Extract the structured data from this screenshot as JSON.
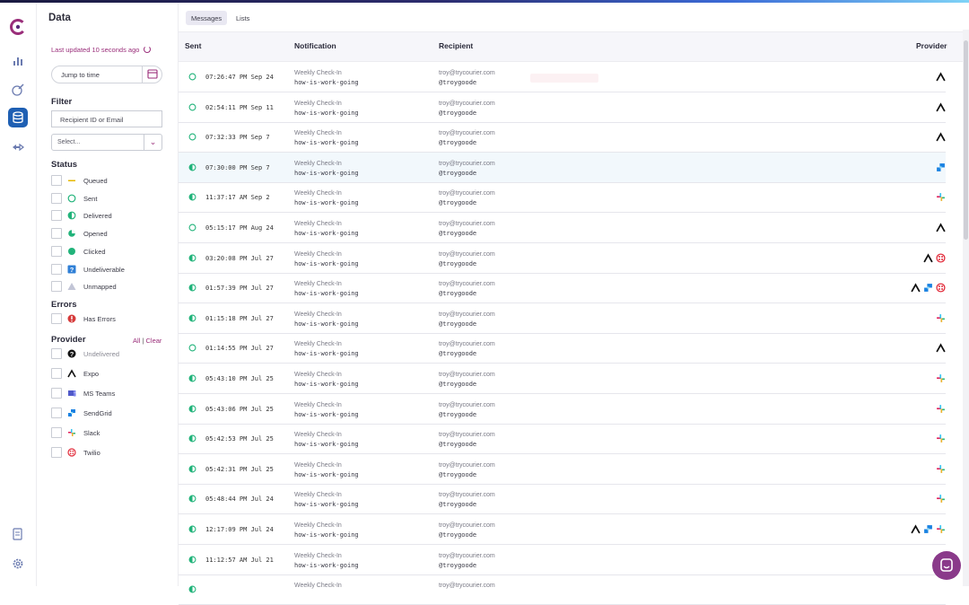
{
  "sidebar": {
    "title": "Data",
    "last_updated": "Last updated 10 seconds ago",
    "jump_placeholder": "Jump to time",
    "filter_heading": "Filter",
    "recipient_placeholder": "Recipient ID or Email",
    "select_placeholder": "Select...",
    "status_heading": "Status",
    "status_items": [
      {
        "label": "Queued",
        "icon": "queued-dash-icon"
      },
      {
        "label": "Sent",
        "icon": "circle-outline-icon"
      },
      {
        "label": "Delivered",
        "icon": "half-circle-icon"
      },
      {
        "label": "Opened",
        "icon": "three-quarter-circle-icon"
      },
      {
        "label": "Clicked",
        "icon": "filled-circle-icon"
      },
      {
        "label": "Undeliverable",
        "icon": "question-square-icon"
      },
      {
        "label": "Unmapped",
        "icon": "triangle-icon"
      }
    ],
    "errors_heading": "Errors",
    "error_items": [
      {
        "label": "Has Errors",
        "icon": "error-icon"
      }
    ],
    "provider_heading": "Provider",
    "provider_all": "All",
    "provider_sep": "|",
    "provider_clear": "Clear",
    "provider_items": [
      {
        "label": "Undelivered",
        "icon": "undelivered-question-icon"
      },
      {
        "label": "Expo",
        "icon": "expo-icon"
      },
      {
        "label": "MS Teams",
        "icon": "ms-teams-icon"
      },
      {
        "label": "SendGrid",
        "icon": "sendgrid-icon"
      },
      {
        "label": "Slack",
        "icon": "slack-icon"
      },
      {
        "label": "Twilio",
        "icon": "twilio-icon"
      }
    ]
  },
  "tabs": [
    {
      "label": "Messages",
      "active": true
    },
    {
      "label": "Lists",
      "active": false
    }
  ],
  "table": {
    "columns": {
      "sent": "Sent",
      "notification": "Notification",
      "recipient": "Recipient",
      "provider": "Provider"
    },
    "rows": [
      {
        "status": "sent",
        "sent": "07:26:47 PM Sep 24",
        "notification": "Weekly Check-In",
        "template": "how-is-work-going",
        "email": "troy@trycourier.com",
        "handle": "@troygoode",
        "providers": [
          "expo"
        ]
      },
      {
        "status": "sent",
        "sent": "02:54:11 PM Sep 11",
        "notification": "Weekly Check-In",
        "template": "how-is-work-going",
        "email": "troy@trycourier.com",
        "handle": "@troygoode",
        "providers": [
          "expo"
        ]
      },
      {
        "status": "sent",
        "sent": "07:32:33 PM Sep 7",
        "notification": "Weekly Check-In",
        "template": "how-is-work-going",
        "email": "troy@trycourier.com",
        "handle": "@troygoode",
        "providers": [
          "expo"
        ]
      },
      {
        "status": "delivered",
        "sent": "07:30:00 PM Sep 7",
        "notification": "Weekly Check-In",
        "template": "how-is-work-going",
        "email": "troy@trycourier.com",
        "handle": "@troygoode",
        "providers": [
          "sendgrid"
        ],
        "highlight": true
      },
      {
        "status": "delivered",
        "sent": "11:37:17 AM Sep 2",
        "notification": "Weekly Check-In",
        "template": "how-is-work-going",
        "email": "troy@trycourier.com",
        "handle": "@troygoode",
        "providers": [
          "slack"
        ]
      },
      {
        "status": "sent",
        "sent": "05:15:17 PM Aug 24",
        "notification": "Weekly Check-In",
        "template": "how-is-work-going",
        "email": "troy@trycourier.com",
        "handle": "@troygoode",
        "providers": [
          "expo"
        ]
      },
      {
        "status": "delivered",
        "sent": "03:20:08 PM Jul 27",
        "notification": "Weekly Check-In",
        "template": "how-is-work-going",
        "email": "troy@trycourier.com",
        "handle": "@troygoode",
        "providers": [
          "expo",
          "twilio"
        ]
      },
      {
        "status": "delivered",
        "sent": "01:57:39 PM Jul 27",
        "notification": "Weekly Check-In",
        "template": "how-is-work-going",
        "email": "troy@trycourier.com",
        "handle": "@troygoode",
        "providers": [
          "expo",
          "sendgrid",
          "twilio"
        ]
      },
      {
        "status": "delivered",
        "sent": "01:15:18 PM Jul 27",
        "notification": "Weekly Check-In",
        "template": "how-is-work-going",
        "email": "troy@trycourier.com",
        "handle": "@troygoode",
        "providers": [
          "slack"
        ]
      },
      {
        "status": "sent",
        "sent": "01:14:55 PM Jul 27",
        "notification": "Weekly Check-In",
        "template": "how-is-work-going",
        "email": "troy@trycourier.com",
        "handle": "@troygoode",
        "providers": [
          "expo"
        ]
      },
      {
        "status": "delivered",
        "sent": "05:43:10 PM Jul 25",
        "notification": "Weekly Check-In",
        "template": "how-is-work-going",
        "email": "troy@trycourier.com",
        "handle": "@troygoode",
        "providers": [
          "slack"
        ]
      },
      {
        "status": "delivered",
        "sent": "05:43:06 PM Jul 25",
        "notification": "Weekly Check-In",
        "template": "how-is-work-going",
        "email": "troy@trycourier.com",
        "handle": "@troygoode",
        "providers": [
          "slack"
        ]
      },
      {
        "status": "delivered",
        "sent": "05:42:53 PM Jul 25",
        "notification": "Weekly Check-In",
        "template": "how-is-work-going",
        "email": "troy@trycourier.com",
        "handle": "@troygoode",
        "providers": [
          "slack"
        ]
      },
      {
        "status": "delivered",
        "sent": "05:42:31 PM Jul 25",
        "notification": "Weekly Check-In",
        "template": "how-is-work-going",
        "email": "troy@trycourier.com",
        "handle": "@troygoode",
        "providers": [
          "slack"
        ]
      },
      {
        "status": "delivered",
        "sent": "05:48:44 PM Jul 24",
        "notification": "Weekly Check-In",
        "template": "how-is-work-going",
        "email": "troy@trycourier.com",
        "handle": "@troygoode",
        "providers": [
          "slack"
        ]
      },
      {
        "status": "delivered",
        "sent": "12:17:09 PM Jul 24",
        "notification": "Weekly Check-In",
        "template": "how-is-work-going",
        "email": "troy@trycourier.com",
        "handle": "@troygoode",
        "providers": [
          "expo",
          "sendgrid",
          "slack"
        ]
      },
      {
        "status": "delivered",
        "sent": "11:12:57 AM Jul 21",
        "notification": "Weekly Check-In",
        "template": "how-is-work-going",
        "email": "troy@trycourier.com",
        "handle": "@troygoode",
        "providers": []
      },
      {
        "status": "delivered",
        "sent": "",
        "notification": "Weekly Check-In",
        "template": "",
        "email": "troy@trycourier.com",
        "handle": "",
        "providers": []
      }
    ]
  },
  "colors": {
    "accent": "#9a2e7a",
    "status_green": "#21b37a",
    "active_nav": "#1e5fb3",
    "chat_button": "#8a3a8a"
  }
}
